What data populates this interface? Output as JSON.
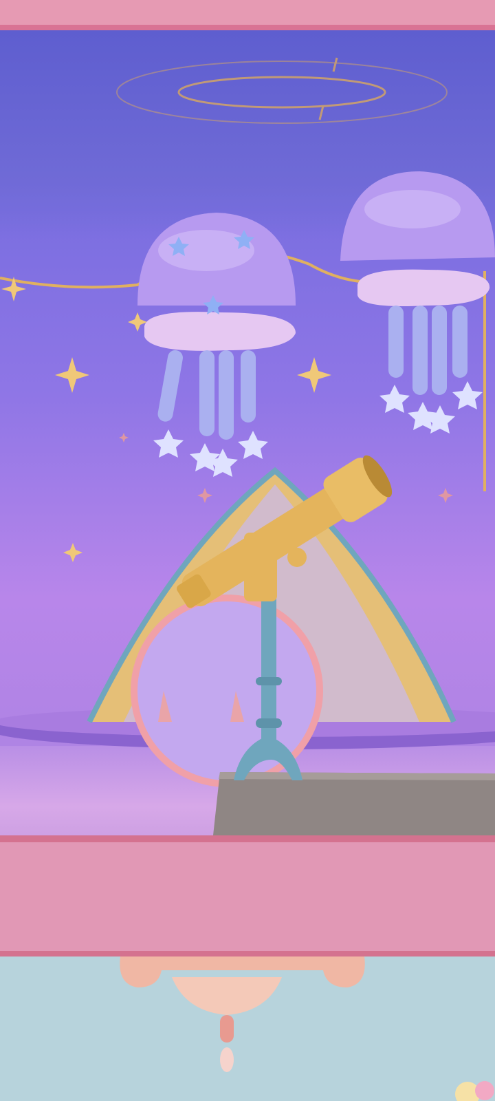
{
  "scene": {
    "colors": {
      "band": "#e69ab3",
      "sky_top": "#6f67d8",
      "sky_bottom": "#b886ea",
      "jellyfish": "#b79af0",
      "telescope": "#e4b45c",
      "stand": "#6fa6bd",
      "tent": "#e5bf77",
      "lower_room": "#b7d3dc"
    },
    "icons": [
      "sparkle-icon",
      "star-icon"
    ]
  }
}
